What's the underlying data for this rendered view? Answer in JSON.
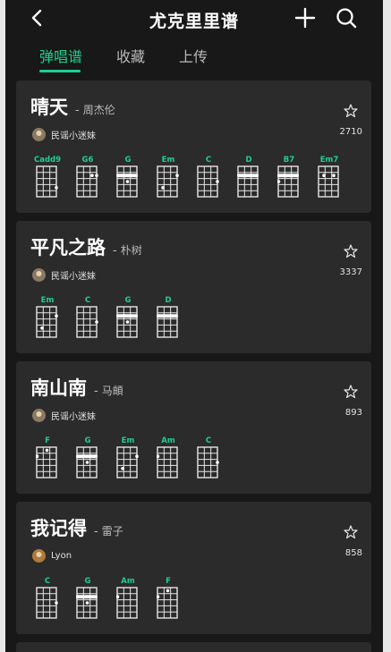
{
  "header": {
    "title": "尤克里里谱",
    "back_icon": "chevron-left-icon",
    "add_icon": "plus-icon",
    "search_icon": "search-icon"
  },
  "tabs": [
    {
      "label": "弹唱谱",
      "active": true
    },
    {
      "label": "收藏",
      "active": false
    },
    {
      "label": "上传",
      "active": false
    }
  ],
  "colors": {
    "accent": "#1fcf8f",
    "background": "#181818",
    "card": "#2b2b2b"
  },
  "songs": [
    {
      "title": "晴天",
      "separator": "-",
      "artist": "周杰伦",
      "uploader": "民谣小迷妹",
      "favorites": "2710",
      "chords": [
        {
          "name": "Cadd9",
          "dots": [
            [
              4,
              4
            ]
          ],
          "bar": null
        },
        {
          "name": "G6",
          "dots": [
            [
              3,
              2
            ],
            [
              4,
              2
            ]
          ],
          "bar": null
        },
        {
          "name": "G",
          "dots": [
            [
              2,
              3
            ]
          ],
          "bar": 2
        },
        {
          "name": "Em",
          "dots": [
            [
              1,
              4
            ],
            [
              4,
              2
            ]
          ],
          "bar": null
        },
        {
          "name": "C",
          "dots": [
            [
              4,
              3
            ]
          ],
          "bar": null
        },
        {
          "name": "D",
          "dots": [],
          "bar": 2
        },
        {
          "name": "B7",
          "dots": [
            [
              0,
              3
            ],
            [
              2,
              2
            ]
          ],
          "bar": 2
        },
        {
          "name": "Em7",
          "dots": [
            [
              1,
              2
            ],
            [
              3,
              2
            ]
          ],
          "bar": null
        }
      ]
    },
    {
      "title": "平凡之路",
      "separator": "-",
      "artist": "朴树",
      "uploader": "民谣小迷妹",
      "favorites": "3337",
      "chords": [
        {
          "name": "Em",
          "dots": [
            [
              1,
              4
            ],
            [
              4,
              2
            ]
          ],
          "bar": null
        },
        {
          "name": "C",
          "dots": [
            [
              4,
              3
            ]
          ],
          "bar": null
        },
        {
          "name": "G",
          "dots": [
            [
              2,
              3
            ]
          ],
          "bar": 2
        },
        {
          "name": "D",
          "dots": [],
          "bar": 2
        }
      ]
    },
    {
      "title": "南山南",
      "separator": "-",
      "artist": "马頔",
      "uploader": "民谣小迷妹",
      "favorites": "893",
      "chords": [
        {
          "name": "F",
          "dots": [
            [
              0,
              2
            ],
            [
              2,
              1
            ]
          ],
          "bar": null
        },
        {
          "name": "G",
          "dots": [
            [
              2,
              3
            ]
          ],
          "bar": 2
        },
        {
          "name": "Em",
          "dots": [
            [
              1,
              4
            ],
            [
              4,
              2
            ]
          ],
          "bar": null
        },
        {
          "name": "Am",
          "dots": [
            [
              0,
              2
            ]
          ],
          "bar": null
        },
        {
          "name": "C",
          "dots": [
            [
              4,
              3
            ]
          ],
          "bar": null
        }
      ]
    },
    {
      "title": "我记得",
      "separator": "-",
      "artist": "雷子",
      "uploader": "Lyon",
      "favorites": "858",
      "chords": [
        {
          "name": "C",
          "dots": [
            [
              4,
              3
            ]
          ],
          "bar": null
        },
        {
          "name": "G",
          "dots": [
            [
              0,
              2
            ],
            [
              2,
              3
            ]
          ],
          "bar": 2
        },
        {
          "name": "Am",
          "dots": [
            [
              0,
              2
            ]
          ],
          "bar": null
        },
        {
          "name": "F",
          "dots": [
            [
              0,
              2
            ],
            [
              2,
              1
            ]
          ],
          "bar": null
        }
      ]
    }
  ]
}
